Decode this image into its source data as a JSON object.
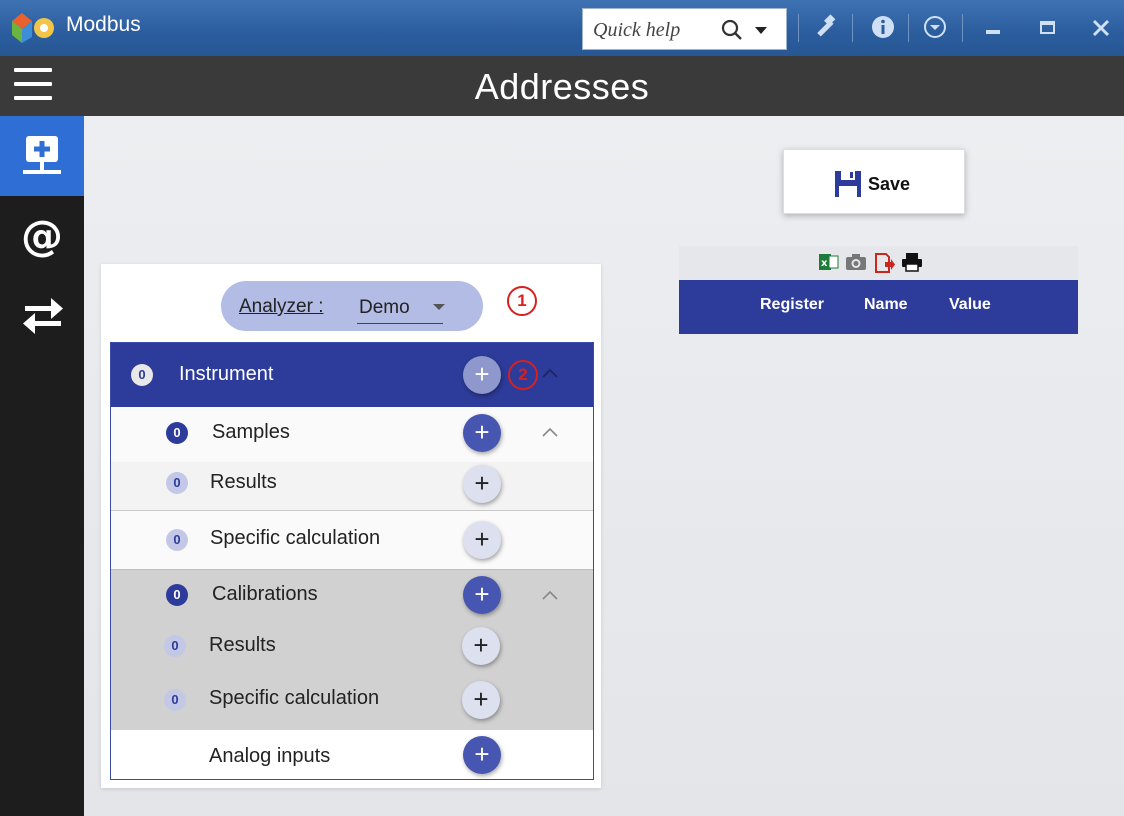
{
  "window": {
    "title": "Modbus",
    "quick_help_placeholder": "Quick help"
  },
  "header": {
    "title": "Addresses"
  },
  "nav": {
    "items": [
      {
        "icon": "network-add-icon",
        "active": true
      },
      {
        "icon": "at-sign-icon",
        "active": false
      },
      {
        "icon": "swap-arrows-icon",
        "active": false
      }
    ]
  },
  "toolbar": {
    "save_label": "Save"
  },
  "table": {
    "toolbar_icons": [
      "excel-icon",
      "camera-icon",
      "export-icon",
      "print-icon"
    ],
    "columns": [
      "Register",
      "Name",
      "Value"
    ],
    "rows": []
  },
  "analyzer": {
    "label": "Analyzer :",
    "value": "Demo"
  },
  "callouts": [
    "1",
    "2"
  ],
  "tree": {
    "instrument": {
      "count": "0",
      "label": "Instrument"
    },
    "samples": {
      "count": "0",
      "label": "Samples"
    },
    "samples_results": {
      "count": "0",
      "label": "Results"
    },
    "samples_specific": {
      "count": "0",
      "label": "Specific calculation"
    },
    "calibrations": {
      "count": "0",
      "label": "Calibrations"
    },
    "calibrations_results": {
      "count": "0",
      "label": "Results"
    },
    "calibrations_specific": {
      "count": "0",
      "label": "Specific calculation"
    },
    "analog_inputs": {
      "label": "Analog inputs"
    }
  },
  "colors": {
    "primary": "#2d3b9a",
    "nav_active": "#2f6fd5",
    "callout": "#d82020"
  }
}
